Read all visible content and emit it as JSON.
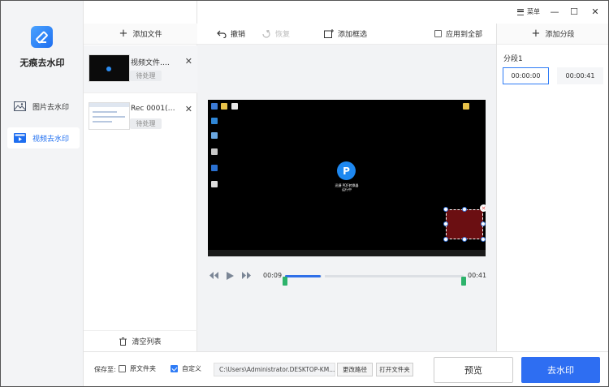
{
  "app": {
    "title": "无痕去水印",
    "brand_color": "#1e6ef0"
  },
  "sidebar": {
    "items": [
      {
        "label": "图片去水印",
        "icon": "image-icon",
        "active": false
      },
      {
        "label": "视频去水印",
        "icon": "video-icon",
        "active": true
      }
    ]
  },
  "window": {
    "menu_label": "菜单"
  },
  "file_panel": {
    "add_label": "添加文件",
    "clear_label": "清空列表",
    "files": [
      {
        "name": "视频文件.…",
        "status": "待处理"
      },
      {
        "name": "Rec 0001(…",
        "status": "待处理"
      }
    ]
  },
  "toolbar": {
    "undo_label": "撤销",
    "redo_label": "恢复",
    "add_box_label": "添加框选",
    "apply_all_label": "应用到全部"
  },
  "video": {
    "overlay_app_name": "迅捷 PDF转换器",
    "overlay_sub": "运行中"
  },
  "player": {
    "current_time": "00:09",
    "end_time": "00:41",
    "progress": 0.2
  },
  "segments": {
    "add_label": "添加分段",
    "label": "分段1",
    "start_time": "00:00:00",
    "end_time": "00:00:41"
  },
  "bottom": {
    "save_to_label": "保存至:",
    "source_folder_label": "原文件夹",
    "custom_label": "自定义",
    "path": "C:\\Users\\Administrator.DESKTOP-KM...",
    "change_path_label": "更改路径",
    "open_folder_label": "打开文件夹",
    "preview_label": "预览",
    "remove_label": "去水印"
  }
}
